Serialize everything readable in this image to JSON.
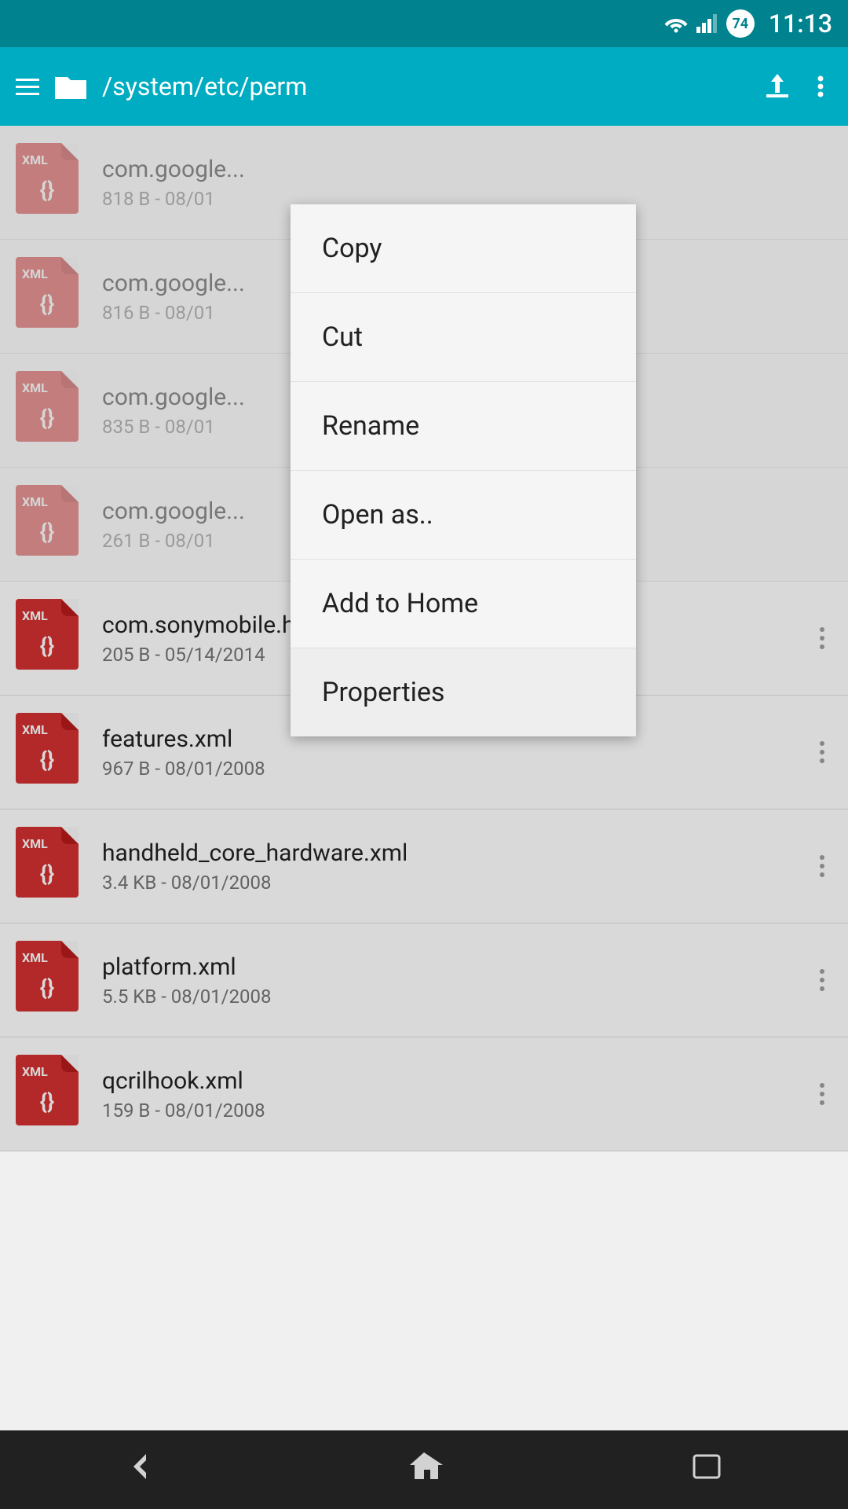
{
  "statusBar": {
    "wifi": "wifi",
    "signal": "signal",
    "battery": "74",
    "time": "11:13"
  },
  "toolbar": {
    "path": "/system/etc/perm"
  },
  "files": [
    {
      "name": "com.google...",
      "meta": "818 B - 08/01",
      "label": "XML"
    },
    {
      "name": "com.google...",
      "meta": "816 B - 08/01",
      "label": "XML"
    },
    {
      "name": "com.google...",
      "meta": "835 B - 08/01",
      "label": "XML"
    },
    {
      "name": "com.google...",
      "meta": "261 B - 08/01",
      "label": "XML"
    },
    {
      "name": "com.sonymobile.home.resour...",
      "meta": "205 B - 05/14/2014",
      "label": "XML"
    },
    {
      "name": "features.xml",
      "meta": "967 B - 08/01/2008",
      "label": "XML"
    },
    {
      "name": "handheld_core_hardware.xml",
      "meta": "3.4 KB - 08/01/2008",
      "label": "XML"
    },
    {
      "name": "platform.xml",
      "meta": "5.5 KB - 08/01/2008",
      "label": "XML"
    },
    {
      "name": "qcrilhook.xml",
      "meta": "159 B - 08/01/2008",
      "label": "XML"
    }
  ],
  "contextMenu": {
    "items": [
      {
        "label": "Copy",
        "active": false
      },
      {
        "label": "Cut",
        "active": false
      },
      {
        "label": "Rename",
        "active": false
      },
      {
        "label": "Open as..",
        "active": false
      },
      {
        "label": "Add to Home",
        "active": false
      },
      {
        "label": "Properties",
        "active": true
      }
    ]
  },
  "navBar": {
    "back": "←",
    "home": "⌂",
    "recent": "▭"
  }
}
